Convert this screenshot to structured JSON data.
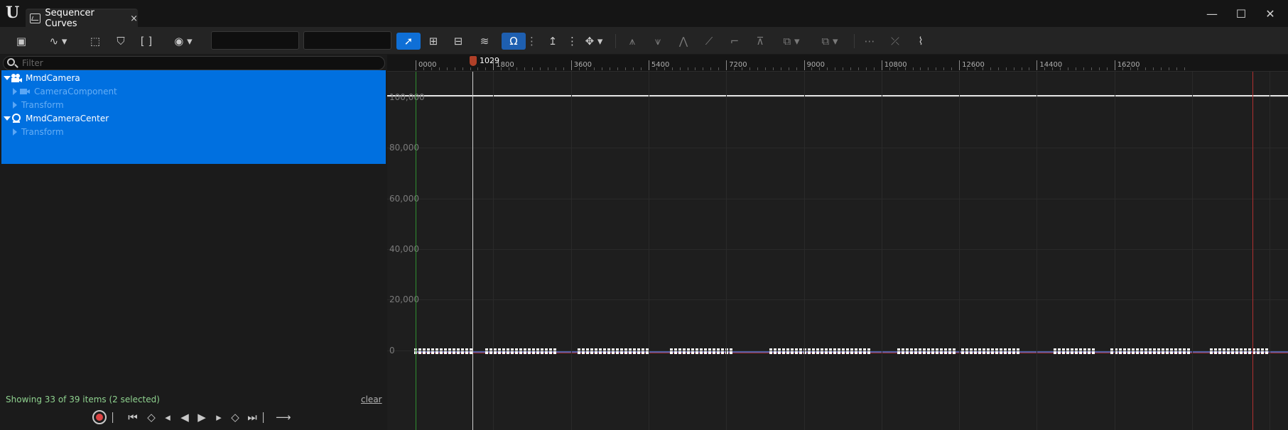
{
  "window": {
    "tab_title": "Sequencer Curves",
    "tab_close": "×",
    "controls": {
      "minimize": "—",
      "maximize": "☐",
      "close": "✕"
    }
  },
  "toolbar": {
    "field1_value": "",
    "field2_value": ""
  },
  "filter": {
    "placeholder": "Filter"
  },
  "tree": {
    "items": [
      {
        "label": "MmdCamera",
        "icon": "camera-actor-icon",
        "expanded": true
      },
      {
        "label": "CameraComponent",
        "icon": "camera-component-icon",
        "expanded": false
      },
      {
        "label": "Transform",
        "icon": "",
        "expanded": false
      },
      {
        "label": "MmdCameraCenter",
        "icon": "actor-center-icon",
        "expanded": true
      },
      {
        "label": "Transform",
        "icon": "",
        "expanded": false
      }
    ]
  },
  "status": {
    "text": "Showing 33 of 39 items (2 selected)",
    "clear_label": "clear"
  },
  "timeline": {
    "playhead_frame": "1029",
    "ticks": [
      "0000",
      "1800",
      "3600",
      "5400",
      "7200",
      "9000",
      "10800",
      "12600",
      "14400",
      "16200"
    ]
  },
  "curve_view": {
    "y_labels": [
      "100,000",
      "80,000",
      "60,000",
      "40,000",
      "20,000",
      "0"
    ],
    "colors": {
      "accent": "#0070e0",
      "playhead": "#b04028",
      "start_marker": "#2f8f2f",
      "end_marker": "#b03030",
      "curve": "#e8e8e8"
    }
  }
}
